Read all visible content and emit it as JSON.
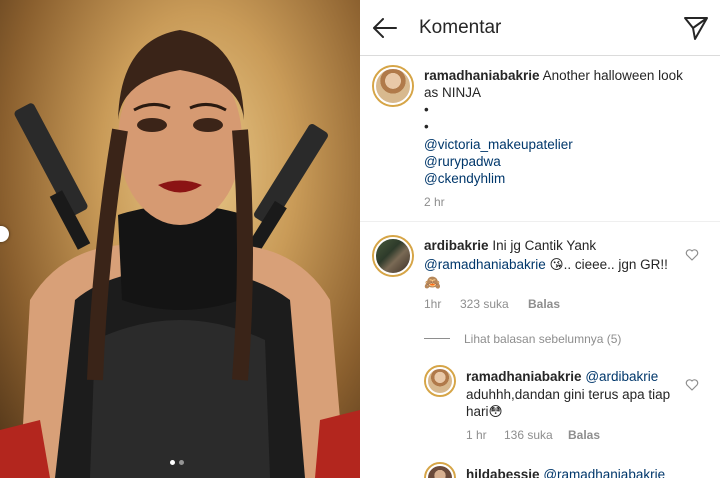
{
  "header": {
    "title": "Komentar"
  },
  "caption": {
    "username": "ramadhaniabakrie",
    "text_line1": "Another halloween look",
    "text_line2": "as NINJA",
    "bullet1": "•",
    "bullet2": "•",
    "mentions": [
      "@victoria_makeupatelier",
      "@rurypadwa",
      "@ckendyhlim"
    ],
    "time": "2 hr"
  },
  "comments": [
    {
      "username": "ardibakrie",
      "text": "Ini jg Cantik Yank",
      "mention": "@ramadhaniabakrie",
      "emoji": "😘",
      "text_tail": ".. cieee.. jgn GR!!",
      "emoji_tail": "🙈",
      "time": "1hr",
      "likes": "323 suka",
      "reply": "Balas",
      "view_replies": "Lihat balasan sebelumnya (5)"
    },
    {
      "username": "ramadhaniabakrie",
      "mention": "@ardibakrie",
      "text_line2": "aduhhh,dandan gini terus apa tiap",
      "text_line3": "hari",
      "emoji": "😳",
      "time": "1 hr",
      "likes": "136 suka",
      "reply": "Balas"
    },
    {
      "username": "hildabessie",
      "mention": "@ramadhaniabakrie"
    }
  ],
  "colors": {
    "link": "#00376b",
    "meta": "#8e8e8e",
    "story_ring": "#d6a547"
  }
}
